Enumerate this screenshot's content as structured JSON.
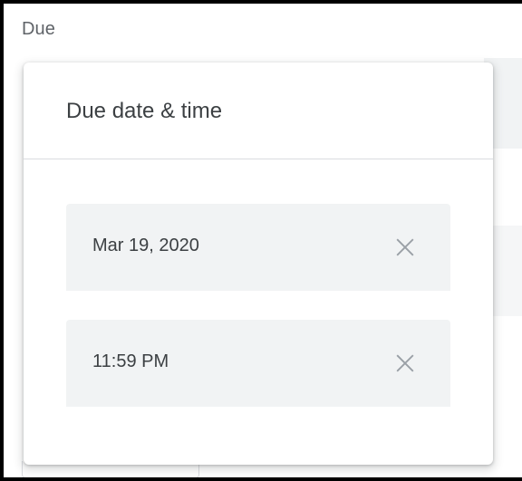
{
  "section": {
    "label": "Due"
  },
  "dialog": {
    "title": "Due date & time",
    "date": {
      "value": "Mar 19, 2020",
      "clear_icon": "close-icon"
    },
    "time": {
      "value": "11:59 PM",
      "clear_icon": "close-icon"
    }
  },
  "colors": {
    "field_bg": "#f1f3f4",
    "text": "#3c4043",
    "label": "#5f6368",
    "divider": "#dadce0",
    "icon": "#9aa0a6"
  }
}
